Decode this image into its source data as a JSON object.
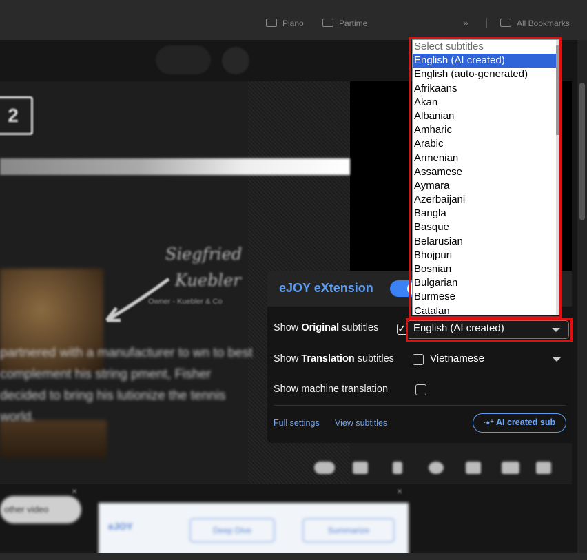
{
  "bookmarks_bar": {
    "folders": [
      "Piano",
      "Partime"
    ],
    "overflow": "»",
    "all_bookmarks": "All Bookmarks"
  },
  "video": {
    "number_badge": "2",
    "signature_name_line1": "Siegfried",
    "signature_name_line2": "Kuebler",
    "signature_sub": "Owner - Kuebler & Co",
    "blurred_caption": "partnered with a manufacturer to wn to best complement his string pment, Fisher decided to bring his lutionize the tennis world."
  },
  "below_video": {
    "pill_label": "other video",
    "ext_brand": "eJOY",
    "ext_button_1": "Deep Dive",
    "ext_button_2": "Summarize"
  },
  "ejoy_panel": {
    "title": "eJOY eXtension",
    "toggle_on": true,
    "original_prefix": "Show ",
    "original_bold": "Original",
    "original_suffix": " subtitles",
    "original_checked": true,
    "original_selected": "English (AI created)",
    "translation_prefix": "Show ",
    "translation_bold": "Translation",
    "translation_suffix": " subtitles",
    "translation_checked": false,
    "translation_language": "Vietnamese",
    "machine_translation_label": "Show machine translation",
    "machine_translation_checked": false,
    "full_settings": "Full settings",
    "view_subtitles": "View subtitles",
    "ai_created_sub": "AI created sub"
  },
  "subtitle_dropdown": {
    "placeholder": "Select subtitles",
    "selected": "English (AI created)",
    "options": [
      "English (AI created)",
      "English (auto-generated)",
      "Afrikaans",
      "Akan",
      "Albanian",
      "Amharic",
      "Arabic",
      "Armenian",
      "Assamese",
      "Aymara",
      "Azerbaijani",
      "Bangla",
      "Basque",
      "Belarusian",
      "Bhojpuri",
      "Bosnian",
      "Bulgarian",
      "Burmese",
      "Catalan"
    ]
  },
  "colors": {
    "highlight": "#e01010",
    "accent": "#5b9cf4",
    "selected_option": "#2f64d9"
  }
}
